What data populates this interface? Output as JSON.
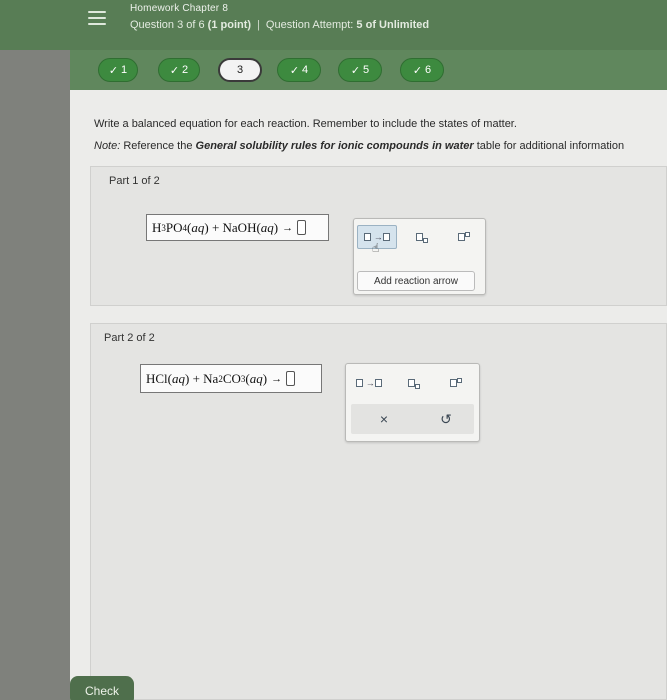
{
  "header": {
    "title": "Homework Chapter 8",
    "question_prefix": "Question 3 of 6",
    "points": "(1 point)",
    "attempt_prefix": "Question Attempt:",
    "attempt_value": "5 of Unlimited"
  },
  "nav": {
    "questions": [
      {
        "label": "1",
        "done": true
      },
      {
        "label": "2",
        "done": true
      },
      {
        "label": "3",
        "done": false
      },
      {
        "label": "4",
        "done": true
      },
      {
        "label": "5",
        "done": true
      },
      {
        "label": "6",
        "done": true
      }
    ],
    "check_glyph": "✓"
  },
  "content": {
    "instruction": "Write a balanced equation for each reaction. Remember to include the states of matter.",
    "note_label": "Note:",
    "note_mid": "Reference the",
    "note_bold": "General solubility rules for ionic compounds in water",
    "note_end": "table for additional information"
  },
  "part1": {
    "label": "Part 1 of 2",
    "tooltip": "Add reaction arrow"
  },
  "part2": {
    "label": "Part 2 of 2",
    "clear_glyph": "×",
    "undo_glyph": "↺"
  },
  "check_label": "Check",
  "icons": [
    "menu-icon",
    "reaction-arrow-icon",
    "subscript-icon",
    "superscript-icon",
    "pointer-hand-icon",
    "clear-icon",
    "undo-icon"
  ]
}
